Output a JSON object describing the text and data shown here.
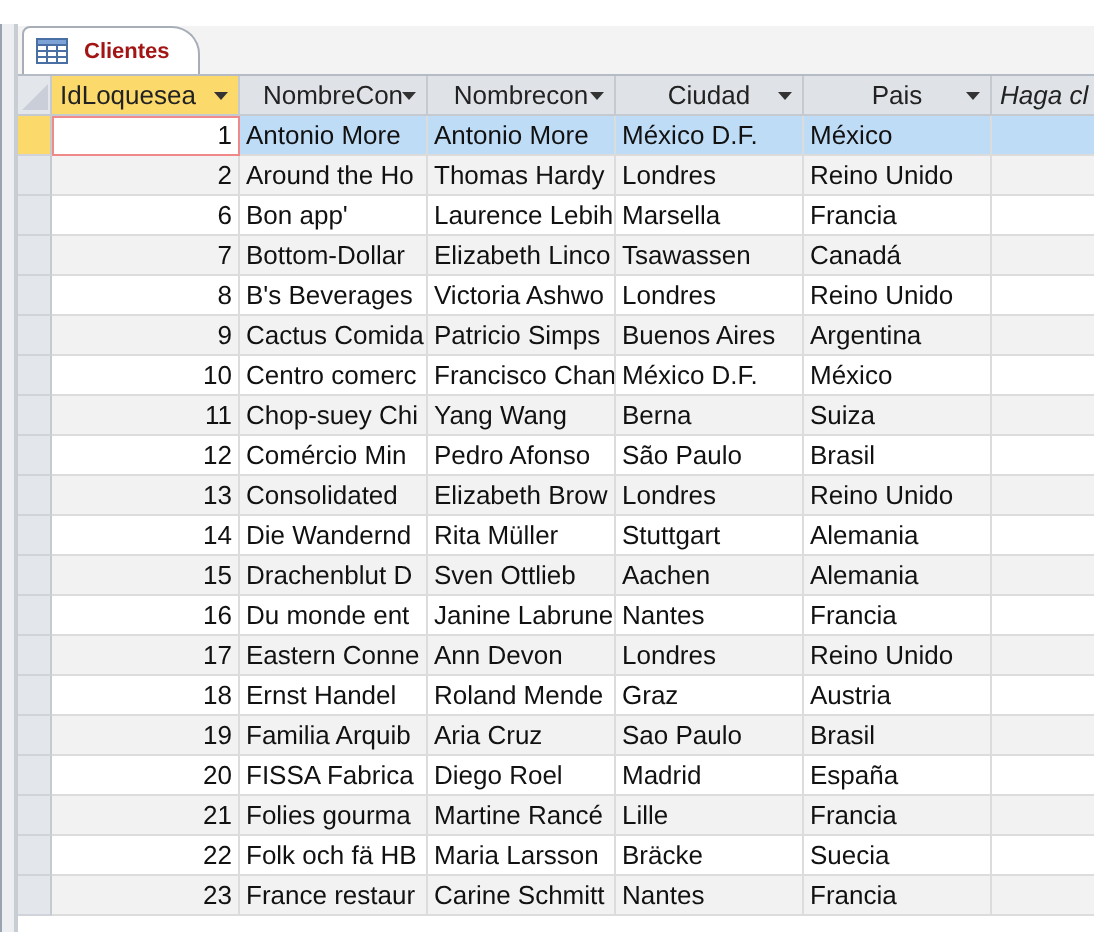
{
  "tab": {
    "label": "Clientes",
    "selected": true
  },
  "columns": [
    {
      "label": "IdLoquesea",
      "selected": true,
      "kind": "field"
    },
    {
      "label": "NombreCon",
      "selected": false,
      "kind": "field"
    },
    {
      "label": "Nombrecon",
      "selected": false,
      "kind": "field"
    },
    {
      "label": "Ciudad",
      "selected": false,
      "kind": "field"
    },
    {
      "label": "Pais",
      "selected": false,
      "kind": "field"
    },
    {
      "label": "Haga cl",
      "selected": false,
      "kind": "add"
    }
  ],
  "rows": [
    {
      "cells": [
        "1",
        "Antonio More",
        "Antonio More",
        "México D.F.",
        "México"
      ],
      "selected": true
    },
    {
      "cells": [
        "2",
        "Around the Ho",
        "Thomas Hardy",
        "Londres",
        "Reino Unido"
      ],
      "selected": false
    },
    {
      "cells": [
        "6",
        "Bon app'",
        "Laurence Lebih",
        "Marsella",
        "Francia"
      ],
      "selected": false
    },
    {
      "cells": [
        "7",
        "Bottom-Dollar",
        "Elizabeth Linco",
        "Tsawassen",
        "Canadá"
      ],
      "selected": false
    },
    {
      "cells": [
        "8",
        "B's Beverages",
        "Victoria Ashwo",
        "Londres",
        "Reino Unido"
      ],
      "selected": false
    },
    {
      "cells": [
        "9",
        "Cactus Comida",
        "Patricio Simps",
        "Buenos Aires",
        "Argentina"
      ],
      "selected": false
    },
    {
      "cells": [
        "10",
        "Centro comerc",
        "Francisco Chan",
        "México D.F.",
        "México"
      ],
      "selected": false
    },
    {
      "cells": [
        "11",
        "Chop-suey Chi",
        "Yang Wang",
        "Berna",
        "Suiza"
      ],
      "selected": false
    },
    {
      "cells": [
        "12",
        "Comércio Min",
        "Pedro Afonso",
        "São Paulo",
        "Brasil"
      ],
      "selected": false
    },
    {
      "cells": [
        "13",
        "Consolidated",
        "Elizabeth Brow",
        "Londres",
        "Reino Unido"
      ],
      "selected": false
    },
    {
      "cells": [
        "14",
        "Die Wandernd",
        "Rita Müller",
        "Stuttgart",
        "Alemania"
      ],
      "selected": false
    },
    {
      "cells": [
        "15",
        "Drachenblut D",
        "Sven Ottlieb",
        "Aachen",
        "Alemania"
      ],
      "selected": false
    },
    {
      "cells": [
        "16",
        "Du monde ent",
        "Janine Labrune",
        "Nantes",
        "Francia"
      ],
      "selected": false
    },
    {
      "cells": [
        "17",
        "Eastern Conne",
        "Ann Devon",
        "Londres",
        "Reino Unido"
      ],
      "selected": false
    },
    {
      "cells": [
        "18",
        "Ernst Handel",
        "Roland Mende",
        "Graz",
        "Austria"
      ],
      "selected": false
    },
    {
      "cells": [
        "19",
        "Familia Arquib",
        "Aria Cruz",
        "Sao Paulo",
        "Brasil"
      ],
      "selected": false
    },
    {
      "cells": [
        "20",
        "FISSA Fabrica",
        "Diego Roel",
        "Madrid",
        "España"
      ],
      "selected": false
    },
    {
      "cells": [
        "21",
        "Folies gourma",
        "Martine Rancé",
        "Lille",
        "Francia"
      ],
      "selected": false
    },
    {
      "cells": [
        "22",
        "Folk och fä HB",
        "Maria Larsson",
        "Bräcke",
        "Suecia"
      ],
      "selected": false
    },
    {
      "cells": [
        "23",
        "France restaur",
        "Carine Schmitt",
        "Nantes",
        "Francia"
      ],
      "selected": false
    }
  ]
}
